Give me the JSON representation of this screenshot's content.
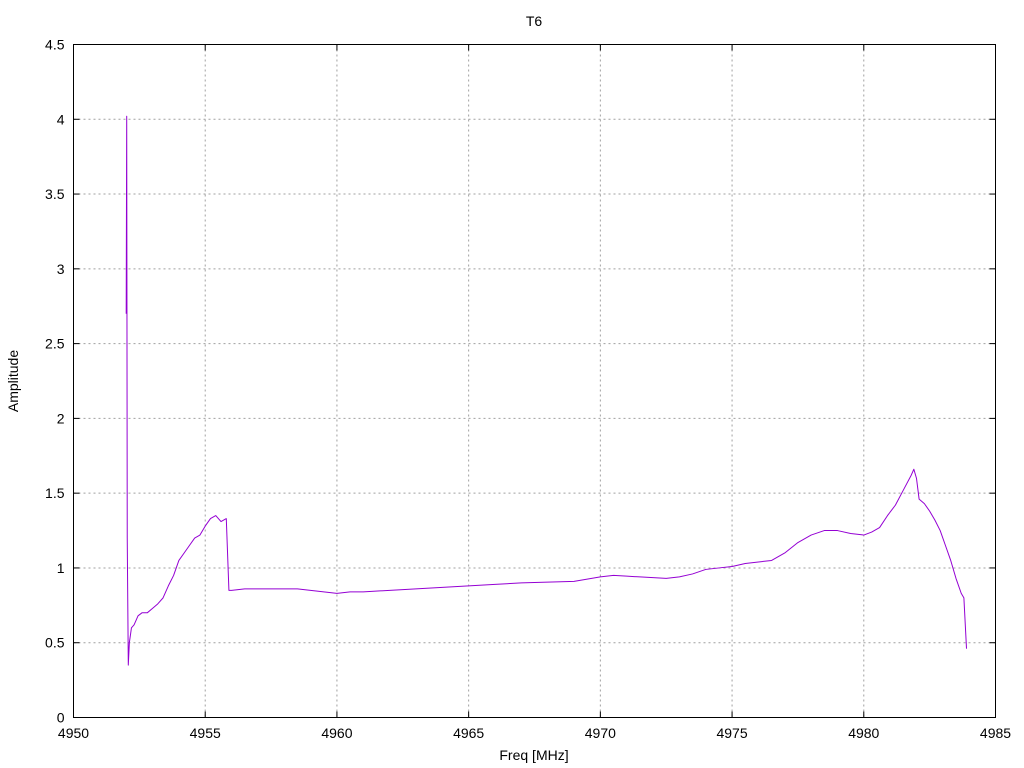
{
  "chart_data": {
    "type": "line",
    "title": "T6",
    "xlabel": "Freq [MHz]",
    "ylabel": "Amplitude",
    "xlim": [
      4950,
      4985
    ],
    "ylim": [
      0,
      4.5
    ],
    "xticks": [
      4950,
      4955,
      4960,
      4965,
      4970,
      4975,
      4980,
      4985
    ],
    "yticks": [
      0,
      0.5,
      1,
      1.5,
      2,
      2.5,
      3,
      3.5,
      4,
      4.5
    ],
    "grid": true,
    "legend": "none",
    "series": [
      {
        "color": "#9400d3",
        "x": [
          4952.0,
          4952.02,
          4952.04,
          4952.08,
          4952.12,
          4952.2,
          4952.3,
          4952.45,
          4952.6,
          4952.8,
          4953.0,
          4953.2,
          4953.4,
          4953.6,
          4953.8,
          4954.0,
          4954.2,
          4954.4,
          4954.6,
          4954.8,
          4955.0,
          4955.2,
          4955.4,
          4955.6,
          4955.8,
          4955.9,
          4956.0,
          4956.5,
          4957.0,
          4957.5,
          4958.0,
          4958.5,
          4959.0,
          4959.5,
          4960.0,
          4960.5,
          4961.0,
          4962.0,
          4963.0,
          4964.0,
          4965.0,
          4966.0,
          4967.0,
          4968.0,
          4969.0,
          4970.0,
          4970.5,
          4971.0,
          4971.5,
          4972.0,
          4972.5,
          4973.0,
          4973.5,
          4974.0,
          4974.5,
          4975.0,
          4975.5,
          4976.0,
          4976.5,
          4977.0,
          4977.5,
          4978.0,
          4978.5,
          4979.0,
          4979.5,
          4980.0,
          4980.3,
          4980.6,
          4980.9,
          4981.2,
          4981.5,
          4981.8,
          4981.9,
          4982.0,
          4982.1,
          4982.3,
          4982.5,
          4982.7,
          4982.9,
          4983.1,
          4983.3,
          4983.5,
          4983.7,
          4983.8,
          4983.9
        ],
        "y": [
          2.7,
          4.02,
          1.2,
          0.35,
          0.5,
          0.6,
          0.62,
          0.68,
          0.7,
          0.7,
          0.73,
          0.76,
          0.8,
          0.88,
          0.95,
          1.05,
          1.1,
          1.15,
          1.2,
          1.22,
          1.28,
          1.33,
          1.35,
          1.31,
          1.33,
          0.85,
          0.85,
          0.86,
          0.86,
          0.86,
          0.86,
          0.86,
          0.85,
          0.84,
          0.83,
          0.84,
          0.84,
          0.85,
          0.86,
          0.87,
          0.88,
          0.89,
          0.9,
          0.905,
          0.91,
          0.94,
          0.95,
          0.945,
          0.94,
          0.935,
          0.93,
          0.94,
          0.96,
          0.99,
          1.0,
          1.01,
          1.03,
          1.04,
          1.05,
          1.1,
          1.17,
          1.22,
          1.25,
          1.25,
          1.23,
          1.22,
          1.24,
          1.27,
          1.35,
          1.42,
          1.52,
          1.62,
          1.66,
          1.6,
          1.46,
          1.43,
          1.38,
          1.32,
          1.25,
          1.15,
          1.05,
          0.93,
          0.83,
          0.8,
          0.46
        ]
      }
    ]
  }
}
